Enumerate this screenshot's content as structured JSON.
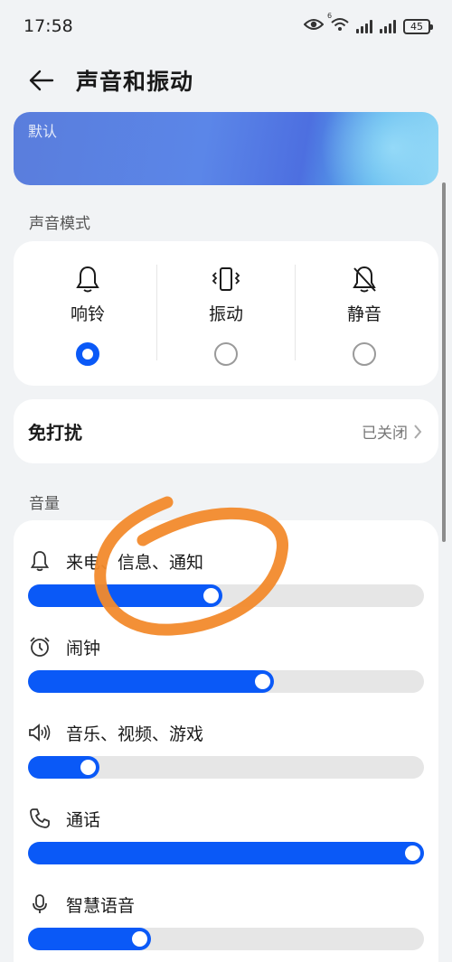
{
  "status_bar": {
    "time": "17:58",
    "wifi_badge": "6",
    "battery": "45"
  },
  "header": {
    "title": "声音和振动"
  },
  "banner": {
    "label": "默认"
  },
  "sound_mode": {
    "section_label": "声音模式",
    "options": [
      {
        "label": "响铃",
        "icon": "bell-icon",
        "selected": true
      },
      {
        "label": "振动",
        "icon": "vibrate-icon",
        "selected": false
      },
      {
        "label": "静音",
        "icon": "bell-off-icon",
        "selected": false
      }
    ]
  },
  "dnd": {
    "title": "免打扰",
    "status": "已关闭"
  },
  "volume": {
    "section_label": "音量",
    "sliders": [
      {
        "label": "来电、信息、通知",
        "icon": "bell-icon",
        "level": 0.49
      },
      {
        "label": "闹钟",
        "icon": "alarm-clock-icon",
        "level": 0.62
      },
      {
        "label": "音乐、视频、游戏",
        "icon": "speaker-icon",
        "level": 0.18
      },
      {
        "label": "通话",
        "icon": "phone-icon",
        "level": 1.0
      },
      {
        "label": "智慧语音",
        "icon": "microphone-icon",
        "level": 0.31
      }
    ]
  },
  "colors": {
    "accent": "#0a59f7",
    "annotation": "#f28a2c"
  }
}
